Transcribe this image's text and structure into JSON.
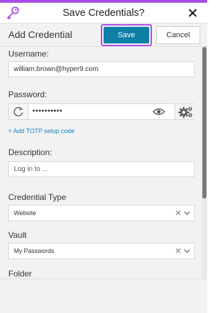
{
  "window": {
    "title": "Save Credentials?",
    "close_icon": "close-icon",
    "accent_color": "#a64ee8"
  },
  "header": {
    "heading": "Add Credential",
    "save_label": "Save",
    "cancel_label": "Cancel",
    "save_color": "#0e7fa6"
  },
  "form": {
    "username": {
      "label": "Username:",
      "value": "william.brown@hyper9.com"
    },
    "password": {
      "label": "Password:",
      "value": "••••••••••",
      "refresh_icon": "refresh-icon",
      "show_icon": "eye-icon",
      "settings_icon": "gear-icon"
    },
    "totp_link": "+ Add TOTP setup code",
    "description": {
      "label": "Description:",
      "placeholder": "Log in to ..."
    },
    "credential_type": {
      "label": "Credential Type",
      "value": "Website"
    },
    "vault": {
      "label": "Vault",
      "value": "My Passwords"
    },
    "folder": {
      "label": "Folder"
    }
  }
}
